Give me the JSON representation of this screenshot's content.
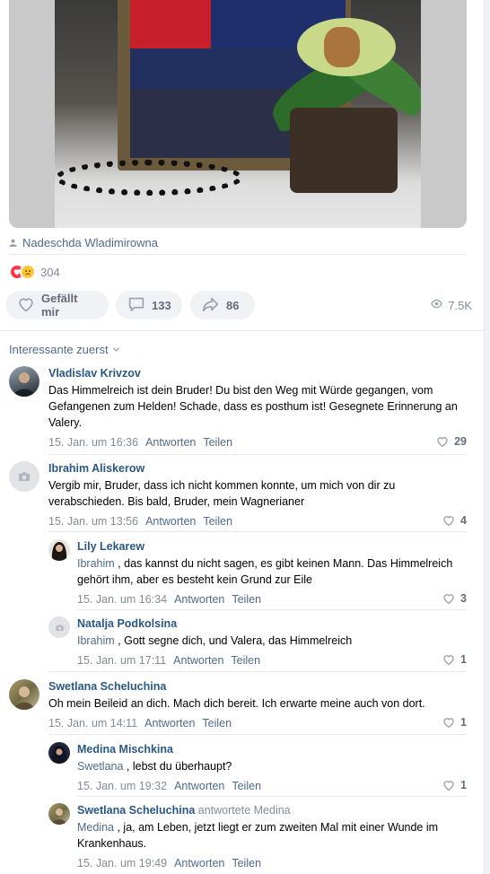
{
  "post": {
    "author": "Nadeschda Wladimirowna",
    "reactions_count": "304",
    "like_label": "Gefällt mir",
    "comments_count": "133",
    "shares_count": "86",
    "views": "7.5K"
  },
  "sort_label": "Interessante zuerst",
  "colors": {
    "link": "#2a5885",
    "muted": "#818c99",
    "heart": "#ff3347"
  },
  "comments": [
    {
      "name": "Vladislav Krivzov",
      "text": "Das Himmelreich ist dein Bruder! Du bist den Weg mit Würde gegangen, vom Gefangenen zum Helden! Schade, dass es posthum ist! Gesegnete Erinnerung an Valery.",
      "date": "15. Jan. um 16:36",
      "reply": "Antworten",
      "share": "Teilen",
      "likes": "29"
    },
    {
      "name": "Ibrahim Aliskerow",
      "text": "Vergib mir, Bruder, dass ich nicht kommen konnte, um mich von dir zu verabschieden. Bis bald, Bruder, mein Wagnerianer",
      "date": "15. Jan. um 13:56",
      "reply": "Antworten",
      "share": "Teilen",
      "likes": "4"
    },
    {
      "name": "Lily Lekarew",
      "mention": "Ibrahim",
      "text": ", das kannst du nicht sagen, es gibt keinen Mann. Das Himmelreich gehört ihm, aber es besteht kein Grund zur Eile",
      "date": "15. Jan. um 16:34",
      "reply": "Antworten",
      "share": "Teilen",
      "likes": "3"
    },
    {
      "name": "Natalja Podkolsina",
      "mention": "Ibrahim",
      "text": ", Gott segne dich, und Valera, das Himmelreich",
      "date": "15. Jan. um 17:11",
      "reply": "Antworten",
      "share": "Teilen",
      "likes": "1"
    },
    {
      "name": "Swetlana Scheluchina",
      "text": "Oh mein Beileid an dich. Mach dich bereit. Ich erwarte meine auch von dort.",
      "date": "15. Jan. um 14:11",
      "reply": "Antworten",
      "share": "Teilen",
      "likes": "1"
    },
    {
      "name": "Medina Mischkina",
      "mention": "Swetlana",
      "text": ", lebst du überhaupt?",
      "date": "15. Jan. um 19:32",
      "reply": "Antworten",
      "share": "Teilen",
      "likes": "1"
    },
    {
      "name": "Swetlana Scheluchina",
      "answered": "antwortete Medina",
      "mention": "Medina",
      "text": ", ja, am Leben, jetzt liegt er zum zweiten Mal mit einer Wunde im Krankenhaus.",
      "date": "15. Jan. um 19:49",
      "reply": "Antworten",
      "share": "Teilen"
    }
  ]
}
